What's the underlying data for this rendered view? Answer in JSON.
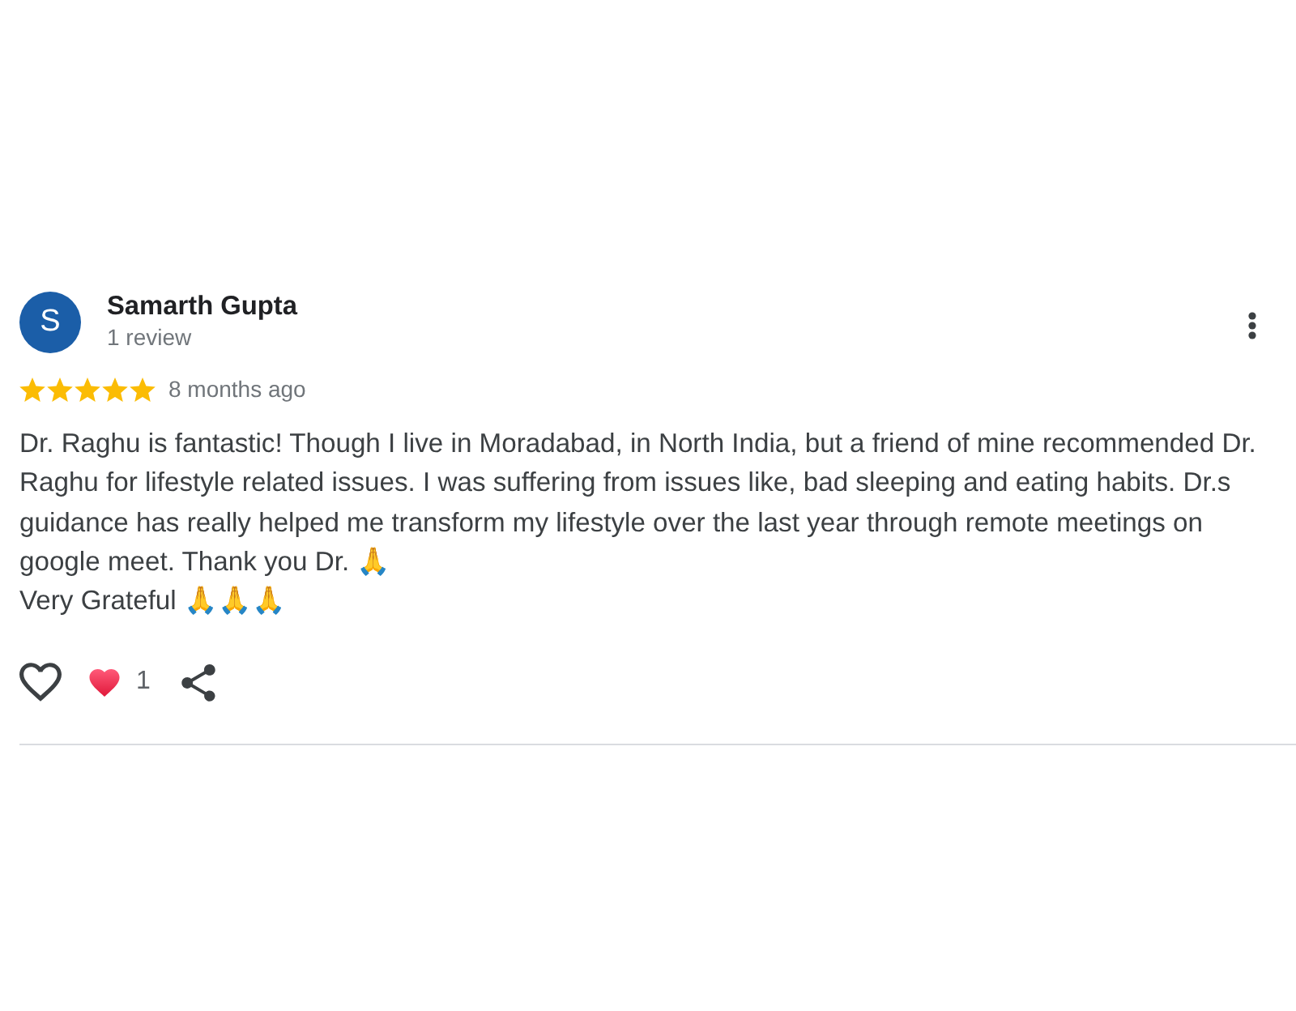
{
  "review": {
    "author": {
      "initial": "S",
      "name": "Samarth Gupta",
      "meta": "1 review"
    },
    "rating": {
      "stars": 5,
      "time": "8 months ago"
    },
    "body": [
      {
        "text": "Dr. Raghu is fantastic! Though I live in Moradabad, in North India, but a friend of mine recommended Dr. Raghu for lifestyle related issues. I was suffering from issues like, bad sleeping and eating habits. Dr.s guidance has really helped me transform my lifestyle over the last year through remote meetings on google meet. Thank you Dr. 🙏"
      },
      {
        "text": "Very Grateful 🙏🙏🙏"
      }
    ],
    "actions": {
      "liked": false,
      "reaction": {
        "kind": "heart",
        "count": "1"
      }
    }
  }
}
